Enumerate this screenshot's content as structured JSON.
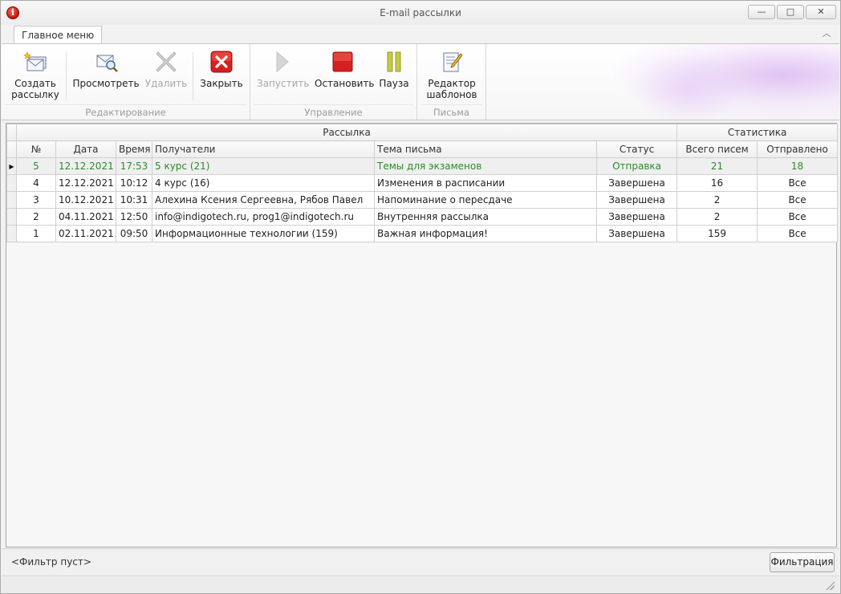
{
  "window": {
    "title": "E-mail рассылки",
    "icon_glyph": "i",
    "minimize_glyph": "—",
    "maximize_glyph": "□",
    "close_glyph": "✕"
  },
  "ribbon": {
    "tab_label": "Главное меню",
    "collapse_glyph": "︿",
    "groups": {
      "editing": {
        "label": "Редактирование",
        "create_label_1": "Создать",
        "create_label_2": "рассылку",
        "view_label": "Просмотреть",
        "delete_label": "Удалить",
        "close_label": "Закрыть"
      },
      "control": {
        "label": "Управление",
        "start_label": "Запустить",
        "stop_label": "Остановить",
        "pause_label": "Пауза"
      },
      "letters": {
        "label": "Письма",
        "editor_label_1": "Редактор",
        "editor_label_2": "шаблонов"
      }
    }
  },
  "grid": {
    "band_mailing": "Рассылка",
    "band_stats": "Статистика",
    "columns": {
      "num": "№",
      "date": "Дата",
      "time": "Время",
      "recipients": "Получатели",
      "subject": "Тема письма",
      "status": "Статус",
      "total": "Всего писем",
      "sent": "Отправлено"
    },
    "active_row_marker": "▶",
    "rows": [
      {
        "num": "5",
        "date": "12.12.2021",
        "time": "17:53",
        "recipients": "5 курс (21)",
        "subject": "Темы для экзаменов",
        "status": "Отправка",
        "total": "21",
        "sent": "18"
      },
      {
        "num": "4",
        "date": "12.12.2021",
        "time": "10:12",
        "recipients": "4 курс (16)",
        "subject": "Изменения в расписании",
        "status": "Завершена",
        "total": "16",
        "sent": "Все"
      },
      {
        "num": "3",
        "date": "10.12.2021",
        "time": "10:31",
        "recipients": "Алехина Ксения Сергеевна, Рябов Павел",
        "subject": "Напоминание о пересдаче",
        "status": "Завершена",
        "total": "2",
        "sent": "Все"
      },
      {
        "num": "2",
        "date": "04.11.2021",
        "time": "12:50",
        "recipients": "info@indigotech.ru, prog1@indigotech.ru",
        "subject": "Внутренняя рассылка",
        "status": "Завершена",
        "total": "2",
        "sent": "Все"
      },
      {
        "num": "1",
        "date": "02.11.2021",
        "time": "09:50",
        "recipients": "Информационные технологии (159)",
        "subject": "Важная информация!",
        "status": "Завершена",
        "total": "159",
        "sent": "Все"
      }
    ]
  },
  "footer": {
    "filter_text": "<Фильтр пуст>",
    "filter_button": "Фильтрация"
  },
  "colors": {
    "active_row_text": "#2d8a2d",
    "close_icon": "#d42020",
    "stop_icon": "#d42020",
    "pause_icon": "#b8b82a"
  }
}
